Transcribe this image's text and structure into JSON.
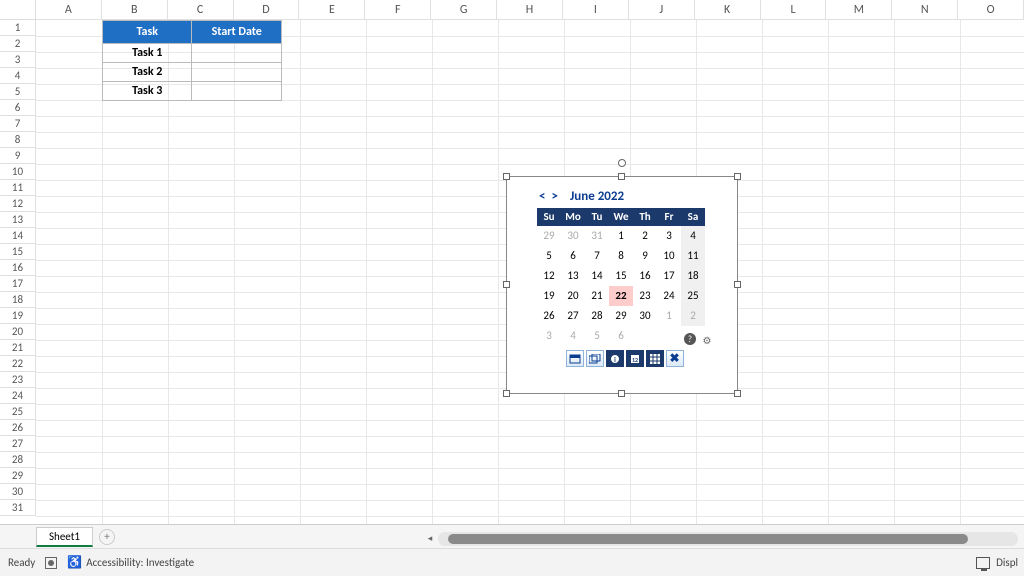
{
  "columns": [
    "A",
    "B",
    "C",
    "D",
    "E",
    "F",
    "G",
    "H",
    "I",
    "J",
    "K",
    "L",
    "M",
    "N",
    "O"
  ],
  "rows": [
    1,
    2,
    3,
    4,
    5,
    6,
    7,
    8,
    9,
    10,
    11,
    12,
    13,
    14,
    15,
    16,
    17,
    18,
    19,
    20,
    21,
    22,
    23,
    24,
    25,
    26,
    27,
    28,
    29,
    30,
    31
  ],
  "table": {
    "headers": {
      "task": "Task",
      "start": "Start Date"
    },
    "rows": [
      {
        "name": "Task 1",
        "start": ""
      },
      {
        "name": "Task 2",
        "start": ""
      },
      {
        "name": "Task 3",
        "start": ""
      }
    ]
  },
  "calendar": {
    "prev": "<",
    "next": ">",
    "title": "June 2022",
    "dow": [
      "Su",
      "Mo",
      "Tu",
      "We",
      "Th",
      "Fr",
      "Sa"
    ],
    "days": [
      {
        "n": 29,
        "out": true
      },
      {
        "n": 30,
        "out": true
      },
      {
        "n": 31,
        "out": true
      },
      {
        "n": 1
      },
      {
        "n": 2
      },
      {
        "n": 3
      },
      {
        "n": 4,
        "alt": true
      },
      {
        "n": 5
      },
      {
        "n": 6
      },
      {
        "n": 7
      },
      {
        "n": 8
      },
      {
        "n": 9
      },
      {
        "n": 10
      },
      {
        "n": 11,
        "alt": true
      },
      {
        "n": 12
      },
      {
        "n": 13
      },
      {
        "n": 14
      },
      {
        "n": 15
      },
      {
        "n": 16
      },
      {
        "n": 17
      },
      {
        "n": 18,
        "alt": true
      },
      {
        "n": 19
      },
      {
        "n": 20
      },
      {
        "n": 21
      },
      {
        "n": 22,
        "today": true
      },
      {
        "n": 23
      },
      {
        "n": 24
      },
      {
        "n": 25,
        "alt": true
      },
      {
        "n": 26
      },
      {
        "n": 27
      },
      {
        "n": 28
      },
      {
        "n": 29
      },
      {
        "n": 30
      },
      {
        "n": 1,
        "out": true
      },
      {
        "n": 2,
        "out": true,
        "alt": true
      },
      {
        "n": 3,
        "out": true
      },
      {
        "n": 4,
        "out": true
      },
      {
        "n": 5,
        "out": true
      },
      {
        "n": 6,
        "out": true
      }
    ],
    "toolbar": [
      "⫘",
      "⫘",
      "❶",
      "⧉",
      "▦",
      "✖"
    ]
  },
  "tabs": {
    "sheet1": "Sheet1",
    "add": "+"
  },
  "status": {
    "ready": "Ready",
    "accessibility": "Accessibility: Investigate",
    "display": "Displ"
  }
}
